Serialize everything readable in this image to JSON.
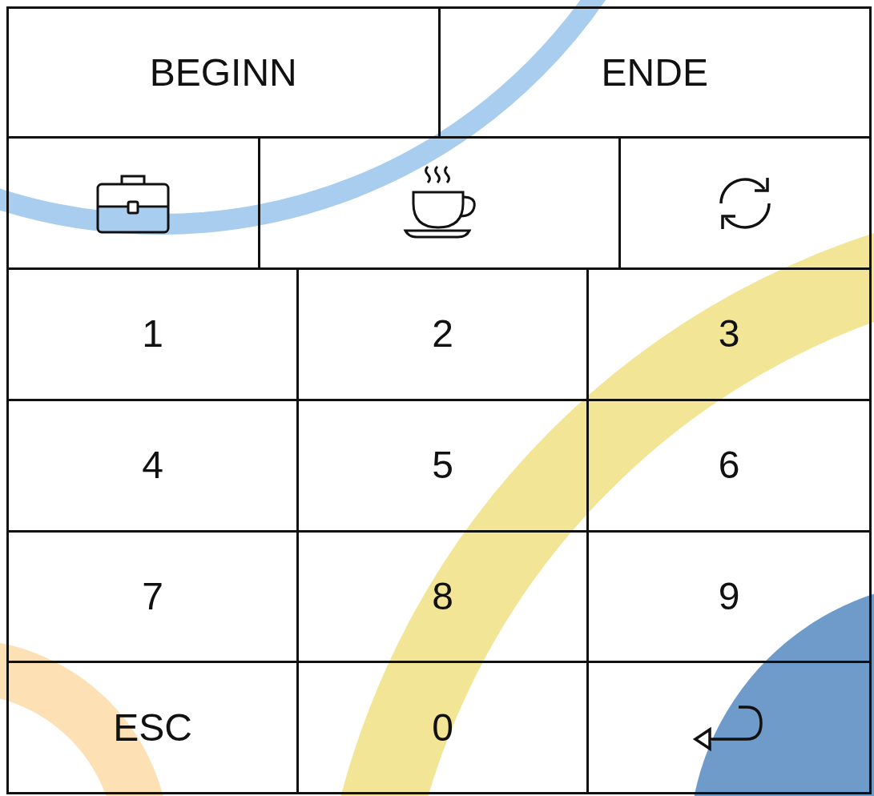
{
  "top_buttons": [
    {
      "label": "BEGINN"
    },
    {
      "label": "ENDE"
    }
  ],
  "icon_buttons": [
    {
      "kind": "briefcase"
    },
    {
      "kind": "coffee"
    },
    {
      "kind": "refresh"
    }
  ],
  "keypad": [
    {
      "kind": "text",
      "label": "1"
    },
    {
      "kind": "text",
      "label": "2"
    },
    {
      "kind": "text",
      "label": "3"
    },
    {
      "kind": "text",
      "label": "4"
    },
    {
      "kind": "text",
      "label": "5"
    },
    {
      "kind": "text",
      "label": "6"
    },
    {
      "kind": "text",
      "label": "7"
    },
    {
      "kind": "text",
      "label": "8"
    },
    {
      "kind": "text",
      "label": "9"
    },
    {
      "kind": "text",
      "label": "ESC"
    },
    {
      "kind": "text",
      "label": "0"
    },
    {
      "kind": "enter"
    }
  ]
}
